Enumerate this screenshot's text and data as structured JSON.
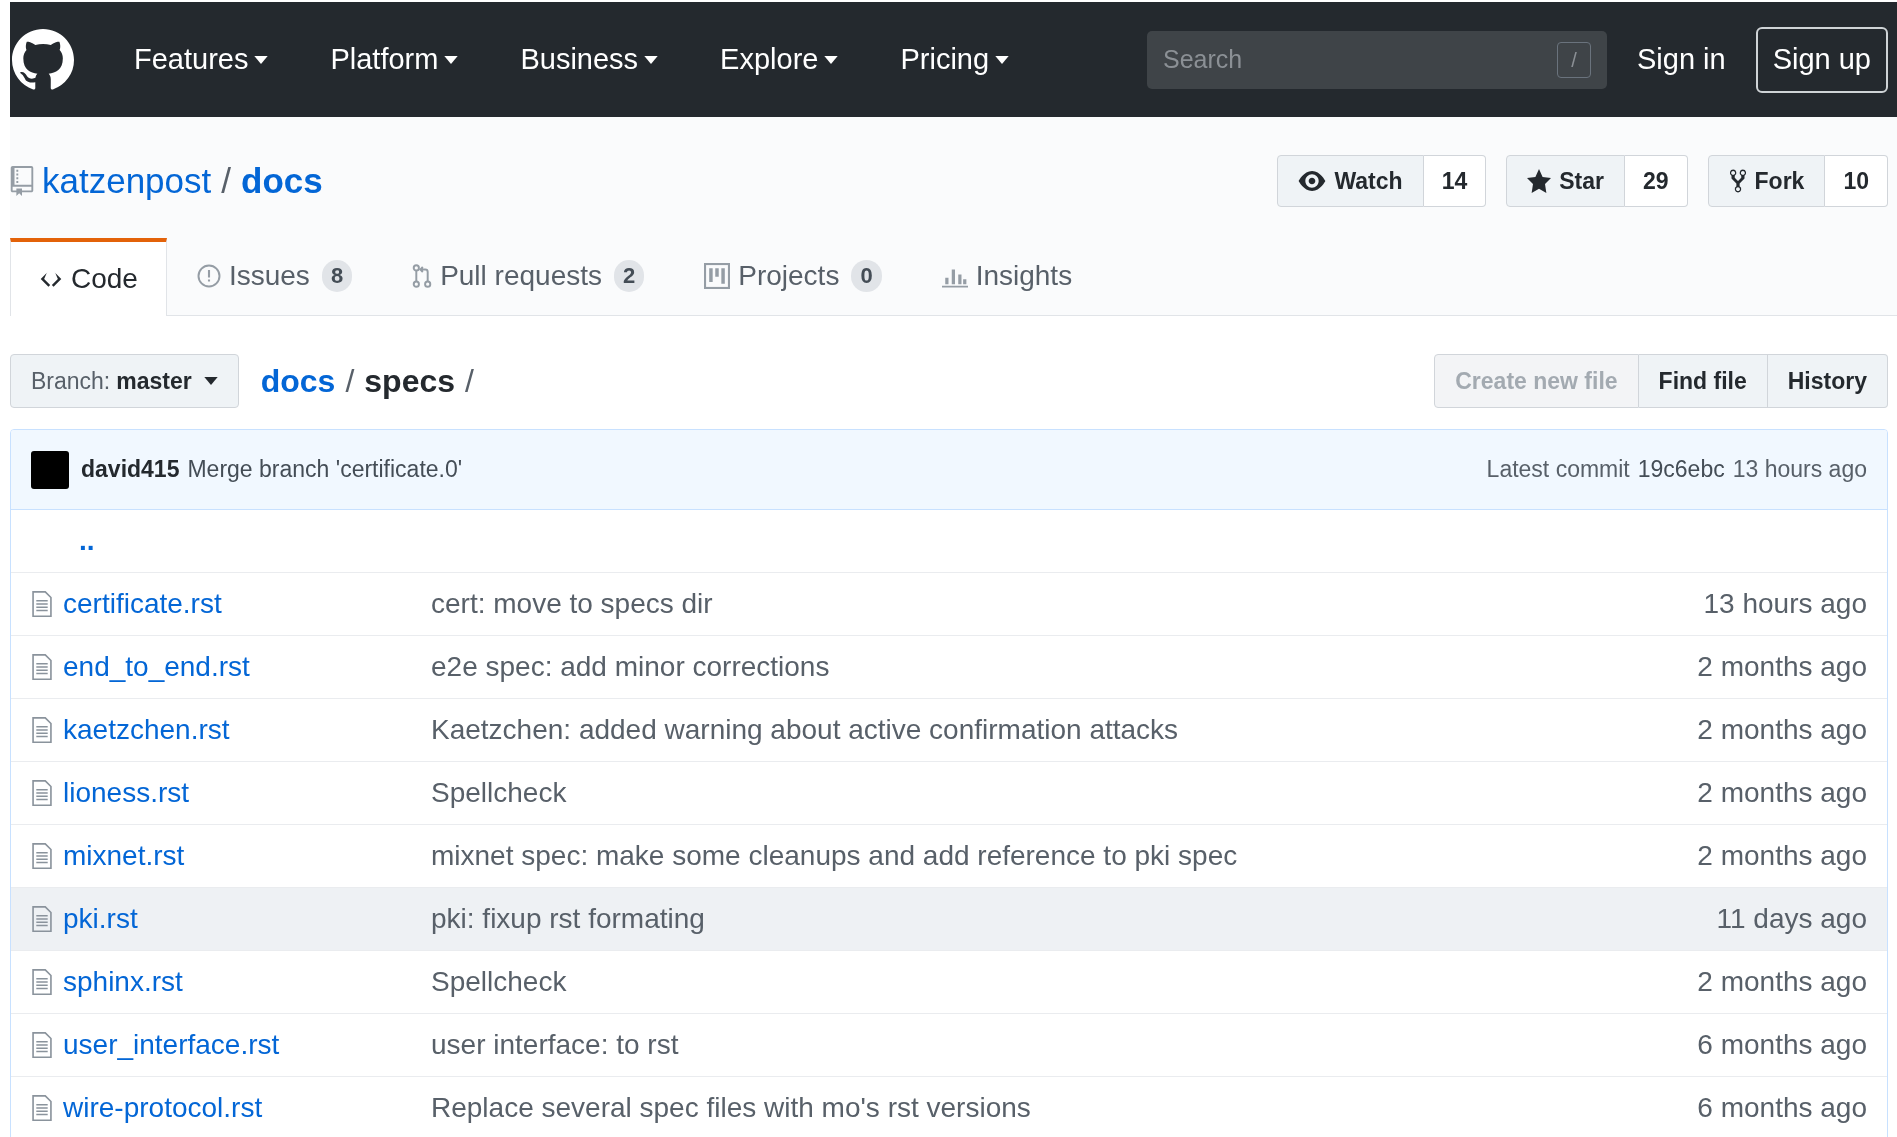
{
  "header": {
    "nav": [
      {
        "label": "Features"
      },
      {
        "label": "Platform"
      },
      {
        "label": "Business"
      },
      {
        "label": "Explore"
      },
      {
        "label": "Pricing"
      }
    ],
    "search": {
      "placeholder": "Search",
      "shortcut": "/"
    },
    "sign_in": "Sign in",
    "sign_up": "Sign up"
  },
  "repo": {
    "owner": "katzenpost",
    "separator": "/",
    "name": "docs",
    "actions": [
      {
        "kind": "watch",
        "label": "Watch",
        "count": "14"
      },
      {
        "kind": "star",
        "label": "Star",
        "count": "29"
      },
      {
        "kind": "fork",
        "label": "Fork",
        "count": "10"
      }
    ]
  },
  "tabs": [
    {
      "kind": "code",
      "label": "Code",
      "selected": true
    },
    {
      "kind": "issues",
      "label": "Issues",
      "count": "8",
      "selected": false
    },
    {
      "kind": "pulls",
      "label": "Pull requests",
      "count": "2",
      "selected": false
    },
    {
      "kind": "projects",
      "label": "Projects",
      "count": "0",
      "selected": false
    },
    {
      "kind": "insights",
      "label": "Insights",
      "selected": false
    }
  ],
  "branch": {
    "prefix": "Branch:",
    "name": "master"
  },
  "breadcrumb": [
    {
      "kind": "link",
      "label": "docs"
    },
    {
      "kind": "separator",
      "label": "/"
    },
    {
      "kind": "current",
      "label": "specs"
    },
    {
      "kind": "separator",
      "label": "/"
    }
  ],
  "file_buttons": [
    {
      "label": "Create new file",
      "disabled": true
    },
    {
      "label": "Find file",
      "disabled": false
    },
    {
      "label": "History",
      "disabled": false
    }
  ],
  "commit": {
    "author": "david415",
    "message": "Merge branch 'certificate.0'",
    "latest_label": "Latest commit",
    "sha": "19c6ebc",
    "age": "13 hours ago"
  },
  "files": [
    {
      "kind": "parent",
      "name": "..",
      "highlighted": false
    },
    {
      "kind": "file",
      "name": "certificate.rst",
      "message": "cert: move to specs dir",
      "age": "13 hours ago",
      "highlighted": false
    },
    {
      "kind": "file",
      "name": "end_to_end.rst",
      "message": "e2e spec: add minor corrections",
      "age": "2 months ago",
      "highlighted": false
    },
    {
      "kind": "file",
      "name": "kaetzchen.rst",
      "message": "Kaetzchen: added warning about active confirmation attacks",
      "age": "2 months ago",
      "highlighted": false
    },
    {
      "kind": "file",
      "name": "lioness.rst",
      "message": "Spellcheck",
      "age": "2 months ago",
      "highlighted": false
    },
    {
      "kind": "file",
      "name": "mixnet.rst",
      "message": "mixnet spec: make some cleanups and add reference to pki spec",
      "age": "2 months ago",
      "highlighted": false
    },
    {
      "kind": "file",
      "name": "pki.rst",
      "message": "pki: fixup rst formating",
      "age": "11 days ago",
      "highlighted": true
    },
    {
      "kind": "file",
      "name": "sphinx.rst",
      "message": "Spellcheck",
      "age": "2 months ago",
      "highlighted": false
    },
    {
      "kind": "file",
      "name": "user_interface.rst",
      "message": "user interface: to rst",
      "age": "6 months ago",
      "highlighted": false
    },
    {
      "kind": "file",
      "name": "wire-protocol.rst",
      "message": "Replace several spec files with mo's rst versions",
      "age": "6 months ago",
      "highlighted": false
    }
  ]
}
